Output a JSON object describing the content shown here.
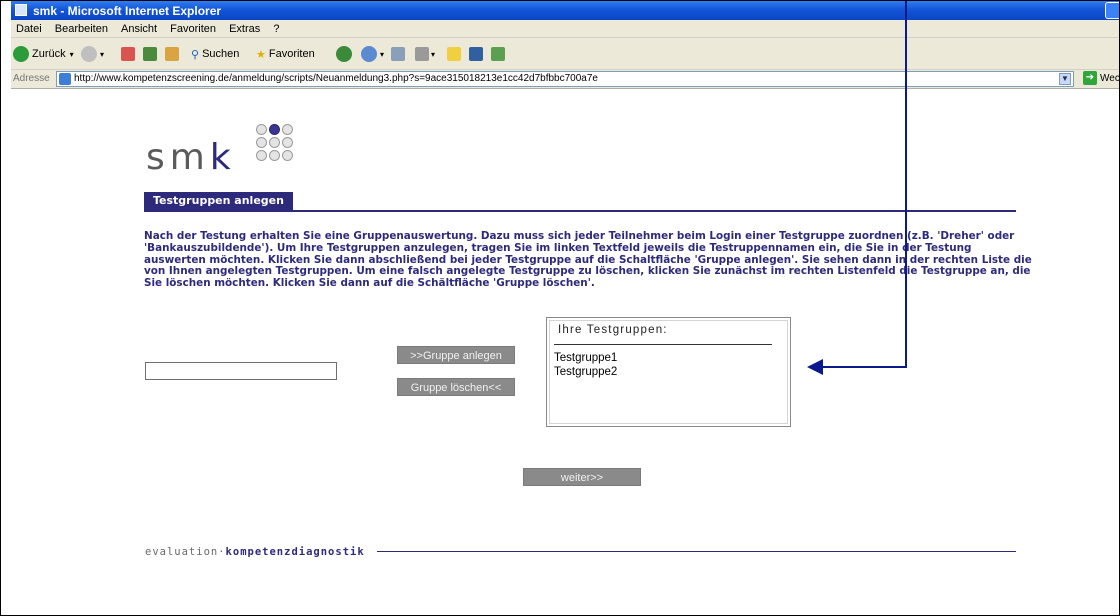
{
  "window": {
    "title": "smk - Microsoft Internet Explorer",
    "app_icon": "ie-page-icon"
  },
  "menu": {
    "items": [
      "Datei",
      "Bearbeiten",
      "Ansicht",
      "Favoriten",
      "Extras",
      "?"
    ]
  },
  "toolbar": {
    "back_label": "Zurück",
    "search_label": "Suchen",
    "favorites_label": "Favoriten"
  },
  "address": {
    "label": "Adresse",
    "url": "http://www.kompetenzscreening.de/anmeldung/scripts/Neuanmeldung3.php?s=9ace315018213e1cc42d7bfbbc700a7e",
    "go_label": "Wechseln zu"
  },
  "page": {
    "logo_prefix": "sm",
    "logo_k": "k",
    "section_tab": "Testgruppen anlegen",
    "instructions": "Nach der Testung erhalten Sie eine Gruppenauswertung. Dazu muss sich jeder Teilnehmer beim Login einer Testgruppe zuordnen (z.B. 'Dreher' oder 'Bankauszubildende'). Um Ihre Testgruppen anzulegen, tragen Sie im linken Textfeld jeweils die Testruppennamen ein, die Sie in der Testung auswerten möchten. Klicken Sie dann abschließend bei jeder Testgruppe auf die Schaltfläche 'Gruppe anlegen'. Sie sehen dann in der rechten Liste die von Ihnen angelegten Testgruppen. Um eine falsch angelegte Testgruppe zu löschen, klicken Sie zunächst im rechten Listenfeld die Testgruppe an, die Sie löschen möchten. Klicken Sie dann auf die Schältfläche 'Gruppe löschen'.",
    "group_input_value": "",
    "add_button": ">>Gruppe anlegen",
    "delete_button": "Gruppe löschen<<",
    "next_button": "weiter>>",
    "list_title": "Ihre Testgruppen:",
    "groups": [
      "Testgruppe1",
      "Testgruppe2"
    ],
    "footer_prefix": "evaluation·",
    "footer_strong": "kompetenzdiagnostik"
  },
  "colors": {
    "brand": "#2e2a7b",
    "button_gray": "#8a8a8a",
    "arrow": "#0a1a8c"
  }
}
